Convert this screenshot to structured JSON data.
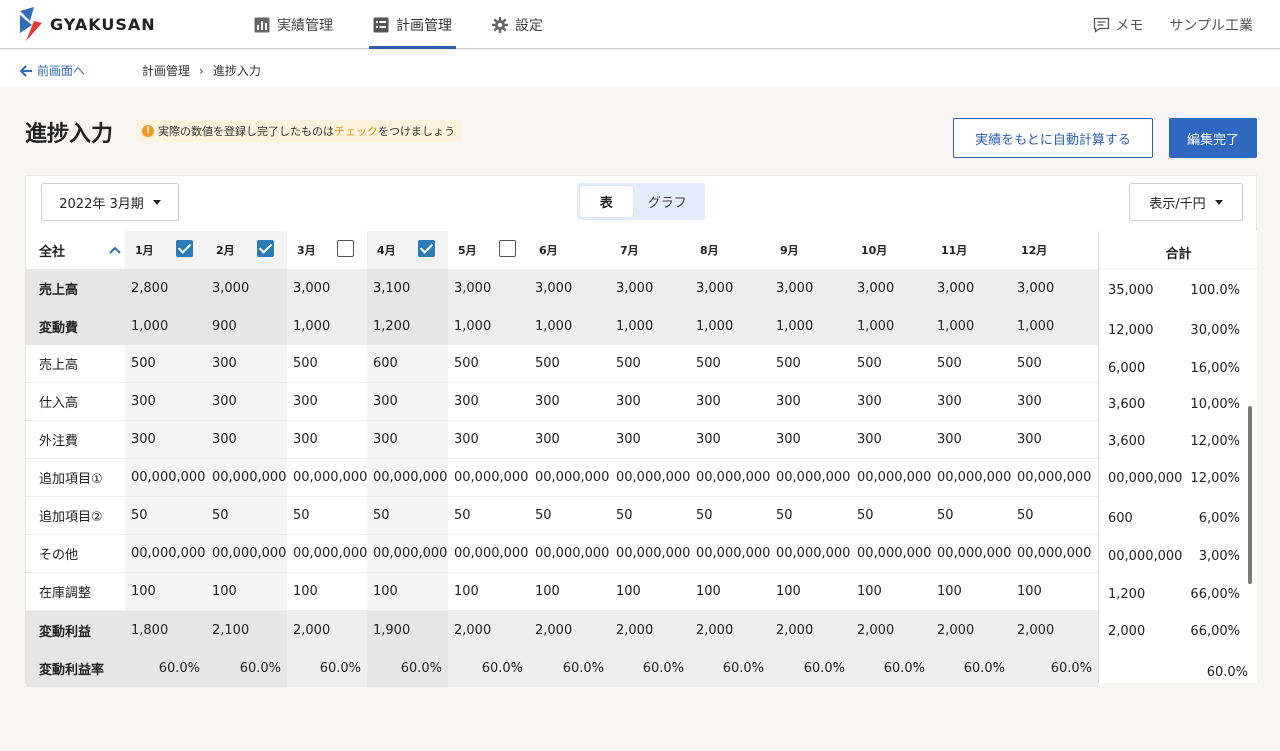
{
  "app": {
    "logo_text": "GYAKUSAN",
    "company": "サンプル工業",
    "memo": "メモ"
  },
  "nav": [
    {
      "label": "実績管理",
      "icon": "chart-icon"
    },
    {
      "label": "計画管理",
      "icon": "list-icon",
      "active": true
    },
    {
      "label": "設定",
      "icon": "gear-icon"
    }
  ],
  "subbar": {
    "back": "前画面へ",
    "crumbs": [
      "計画管理",
      "進捗入力"
    ]
  },
  "page": {
    "title": "進捗入力",
    "hint_pre": "実際の数値を登録し完了したものは",
    "hint_hl": "チェック",
    "hint_post": "をつけましょう",
    "auto_button": "実績をもとに自動計算する",
    "done_button": "編集完了"
  },
  "controls": {
    "period": "2022年 3月期",
    "view_table": "表",
    "view_graph": "グラフ",
    "unit": "表示/千円"
  },
  "table": {
    "corner": "全社",
    "months": [
      "1月",
      "2月",
      "3月",
      "4月",
      "5月",
      "6月",
      "7月",
      "8月",
      "9月",
      "10月",
      "11月",
      "12月"
    ],
    "checked": [
      true,
      true,
      false,
      true,
      false,
      null,
      null,
      null,
      null,
      null,
      null,
      null
    ],
    "total_header": "合計",
    "rows": [
      {
        "label": "売上高",
        "bold": true,
        "values": [
          "2,800",
          "3,000",
          "3,000",
          "3,100",
          "3,000",
          "3,000",
          "3,000",
          "3,000",
          "3,000",
          "3,000",
          "3,000",
          "3,000"
        ],
        "total": "35,000",
        "pct": "100.0%"
      },
      {
        "label": "変動費",
        "bold": true,
        "values": [
          "1,000",
          "900",
          "1,000",
          "1,200",
          "1,000",
          "1,000",
          "1,000",
          "1,000",
          "1,000",
          "1,000",
          "1,000",
          "1,000"
        ],
        "total": "12,000",
        "pct": "30,00%"
      },
      {
        "label": "売上高",
        "bold": false,
        "values": [
          "500",
          "300",
          "500",
          "600",
          "500",
          "500",
          "500",
          "500",
          "500",
          "500",
          "500",
          "500"
        ],
        "total": "6,000",
        "pct": "16,00%"
      },
      {
        "label": "仕入高",
        "bold": false,
        "values": [
          "300",
          "300",
          "300",
          "300",
          "300",
          "300",
          "300",
          "300",
          "300",
          "300",
          "300",
          "300"
        ],
        "total": "3,600",
        "pct": "10,00%"
      },
      {
        "label": "外注費",
        "bold": false,
        "values": [
          "300",
          "300",
          "300",
          "300",
          "300",
          "300",
          "300",
          "300",
          "300",
          "300",
          "300",
          "300"
        ],
        "total": "3,600",
        "pct": "12,00%"
      },
      {
        "label": "追加項目①",
        "bold": false,
        "values": [
          "00,000,000",
          "00,000,000",
          "00,000,000",
          "00,000,000",
          "00,000,000",
          "00,000,000",
          "00,000,000",
          "00,000,000",
          "00,000,000",
          "00,000,000",
          "00,000,000",
          "00,000,000"
        ],
        "total": "00,000,000",
        "pct": "12,00%"
      },
      {
        "label": "追加項目②",
        "bold": false,
        "values": [
          "50",
          "50",
          "50",
          "50",
          "50",
          "50",
          "50",
          "50",
          "50",
          "50",
          "50",
          "50"
        ],
        "total": "600",
        "pct": "6,00%"
      },
      {
        "label": "その他",
        "bold": false,
        "values": [
          "00,000,000",
          "00,000,000",
          "00,000,000",
          "00,000,000",
          "00,000,000",
          "00,000,000",
          "00,000,000",
          "00,000,000",
          "00,000,000",
          "00,000,000",
          "00,000,000",
          "00,000,000"
        ],
        "total": "00,000,000",
        "pct": "3,00%"
      },
      {
        "label": "在庫調整",
        "bold": false,
        "values": [
          "100",
          "100",
          "100",
          "100",
          "100",
          "100",
          "100",
          "100",
          "100",
          "100",
          "100",
          "100"
        ],
        "total": "1,200",
        "pct": "66,00%"
      },
      {
        "label": "変動利益",
        "bold": true,
        "values": [
          "1,800",
          "2,100",
          "2,000",
          "1,900",
          "2,000",
          "2,000",
          "2,000",
          "2,000",
          "2,000",
          "2,000",
          "2,000",
          "2,000"
        ],
        "total": "2,000",
        "pct": "66,00%"
      },
      {
        "label": "変動利益率",
        "bold": true,
        "right": true,
        "values": [
          "60.0%",
          "60.0%",
          "60.0%",
          "60.0%",
          "60.0%",
          "60.0%",
          "60.0%",
          "60.0%",
          "60.0%",
          "60.0%",
          "60.0%",
          "60.0%"
        ],
        "total": "",
        "pct": "60.0%"
      }
    ]
  },
  "colors": {
    "accent": "#2f5fb3",
    "check": "#2a7bb8",
    "hint_bg": "#fdf2dc",
    "hint_icon": "#f09a2a"
  }
}
